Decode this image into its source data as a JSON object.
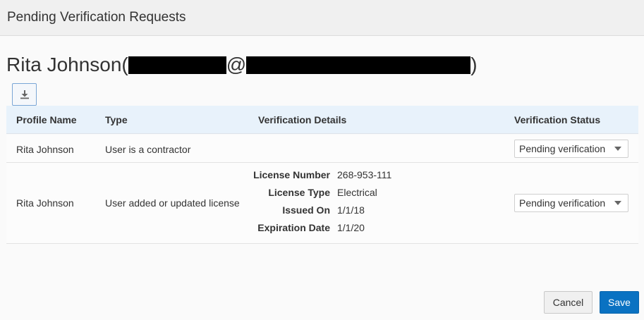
{
  "dialog": {
    "title": "Pending Verification Requests"
  },
  "person": {
    "name": "Rita Johnson(",
    "at": "@",
    "close_paren": ")"
  },
  "toolbar": {
    "download_icon": "download-icon"
  },
  "table": {
    "headers": {
      "profile_name": "Profile Name",
      "type": "Type",
      "verification_details": "Verification Details",
      "verification_status": "Verification Status"
    },
    "rows": [
      {
        "profile_name": "Rita Johnson",
        "type": "User is a contractor",
        "status": "Pending verification"
      },
      {
        "profile_name": "Rita Johnson",
        "type": "User added or updated license",
        "status": "Pending verification",
        "details": [
          {
            "label": "License Number",
            "value": "268-953-111"
          },
          {
            "label": "License Type",
            "value": "Electrical"
          },
          {
            "label": "Issued On",
            "value": "1/1/18"
          },
          {
            "label": "Expiration Date",
            "value": "1/1/20"
          }
        ]
      }
    ]
  },
  "footer": {
    "cancel_label": "Cancel",
    "save_label": "Save"
  },
  "colors": {
    "header_bg": "#f0f0f0",
    "table_header_bg": "#e8f2fb",
    "primary": "#0a72c2",
    "redaction": "#000000"
  }
}
